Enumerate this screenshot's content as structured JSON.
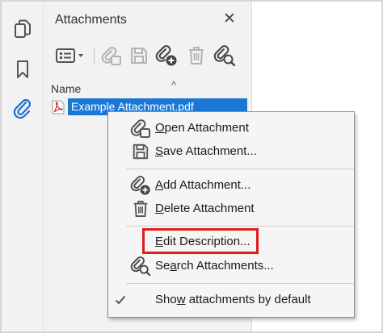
{
  "sidebar": {
    "icons": [
      "pages-icon",
      "bookmark-icon",
      "attachment-icon"
    ]
  },
  "panel": {
    "title": "Attachments",
    "close_label": "✕"
  },
  "toolbar": {
    "buttons": [
      "options-menu",
      "open-attachment",
      "save-attachment",
      "add-attachment",
      "delete-attachment",
      "search-attachments"
    ]
  },
  "list": {
    "column_name": "Name",
    "sort_glyph": "^",
    "rows": [
      {
        "filename": "Example Attachment.pdf",
        "selected": true
      }
    ]
  },
  "context_menu": {
    "items": [
      {
        "pre": "",
        "u": "O",
        "post": "pen Attachment",
        "icon": "open-attachment-icon"
      },
      {
        "pre": "",
        "u": "S",
        "post": "ave Attachment...",
        "icon": "save-attachment-icon"
      },
      {
        "pre": "",
        "u": "A",
        "post": "dd Attachment...",
        "icon": "add-attachment-icon"
      },
      {
        "pre": "",
        "u": "D",
        "post": "elete Attachment",
        "icon": "delete-attachment-icon"
      },
      {
        "pre": "",
        "u": "E",
        "post": "dit Description...",
        "icon": ""
      },
      {
        "pre": "Se",
        "u": "a",
        "post": "rch Attachments...",
        "icon": "search-attachments-icon"
      },
      {
        "pre": "Sho",
        "u": "w",
        "post": " attachments by default",
        "icon": "checkmark-icon",
        "checked": true
      }
    ]
  },
  "colors": {
    "selection": "#1a78d4",
    "highlight_box": "#e01b1b",
    "active_icon": "#1a6fd0"
  }
}
